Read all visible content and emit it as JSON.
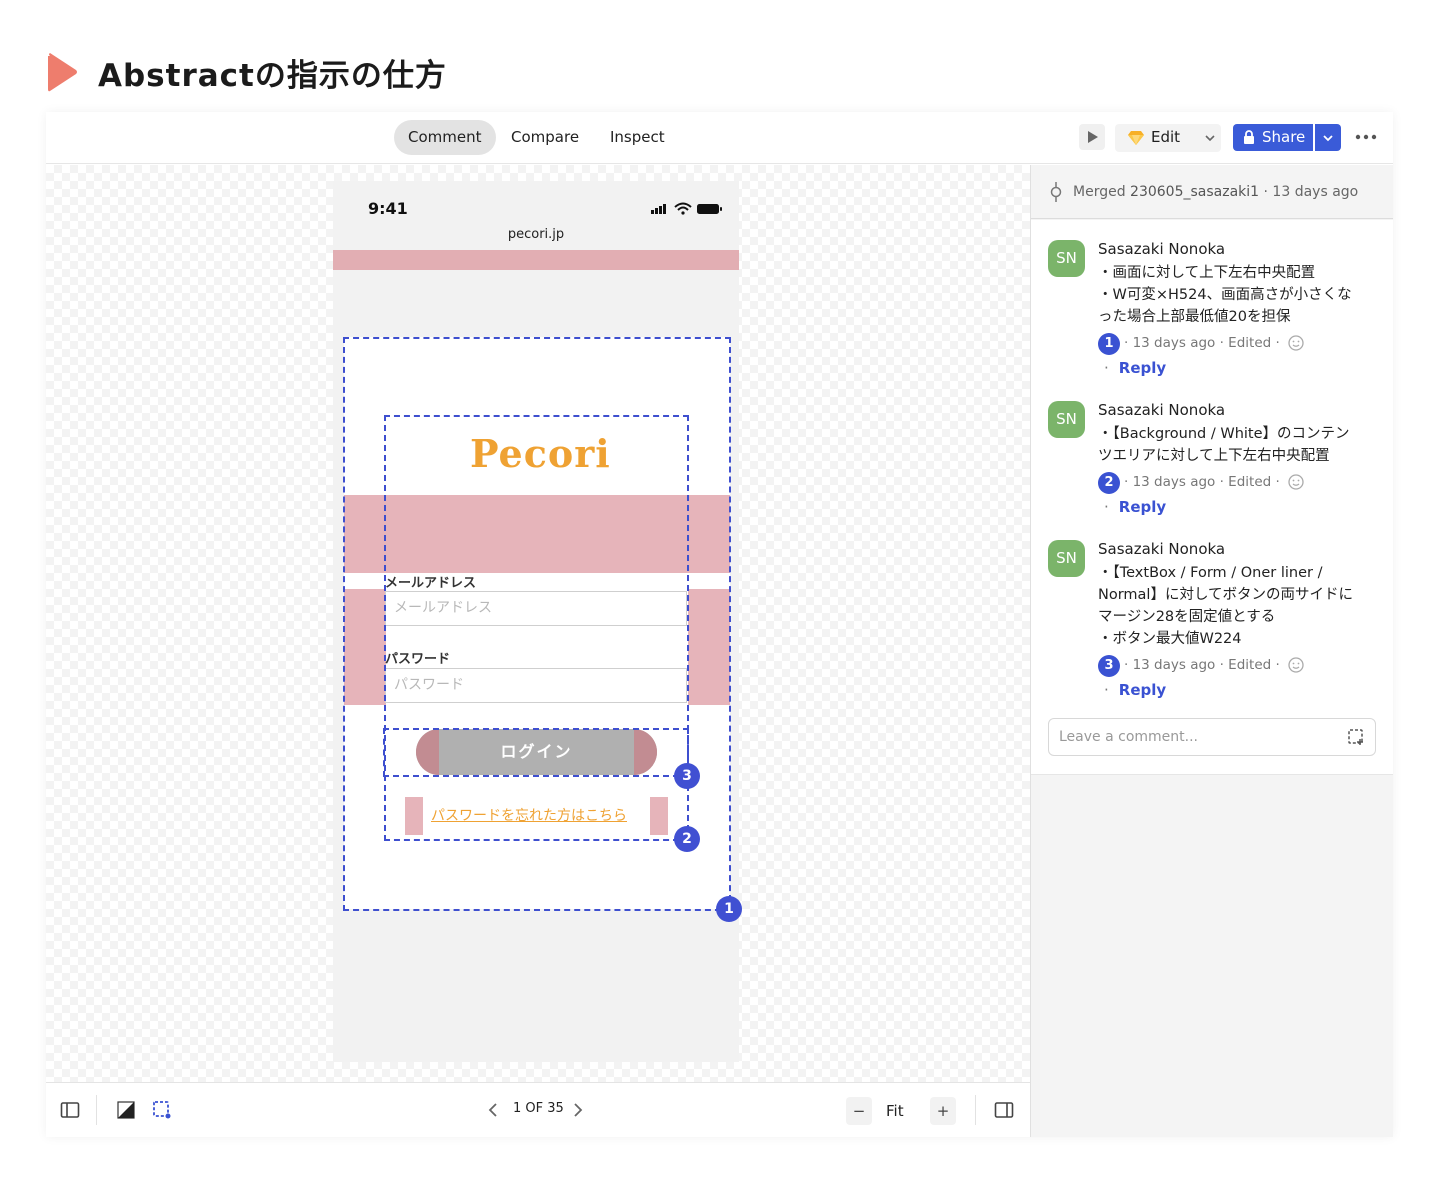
{
  "heading": {
    "title": "Abstractの指示の仕方",
    "icon": "play-icon"
  },
  "topbar": {
    "tabs": [
      {
        "label": "Comment",
        "active": true
      },
      {
        "label": "Compare",
        "active": false
      },
      {
        "label": "Inspect",
        "active": false
      }
    ],
    "edit_label": "Edit",
    "share_label": "Share"
  },
  "phone": {
    "time": "9:41",
    "url": "pecori.jp",
    "logo": "Pecori",
    "email_label": "メールアドレス",
    "email_placeholder": "メールアドレス",
    "password_label": "パスワード",
    "password_placeholder": "パスワード",
    "login_label": "ログイン",
    "forgot_label": "パスワードを忘れた方はこちら"
  },
  "markers": [
    "1",
    "2",
    "3"
  ],
  "bottombar": {
    "pager": "1 OF 35",
    "zoom_label": "Fit",
    "minus": "−",
    "plus": "+"
  },
  "sidebar": {
    "merged_prefix": "Merged",
    "merged_branch": "230605_sasazaki1",
    "merged_time": "· 13 days ago",
    "comments": [
      {
        "initials": "SN",
        "author": "Sasazaki Nonoka",
        "lines": [
          "・画面に対して上下左右中央配置",
          "・W可変×H524、画面高さが小さくな",
          "った場合上部最低値20を担保"
        ],
        "num": "1",
        "meta": "· 13 days ago · Edited ·",
        "reply": "Reply"
      },
      {
        "initials": "SN",
        "author": "Sasazaki Nonoka",
        "lines": [
          "・【Background / White】のコンテン",
          "ツエリアに対して上下左右中央配置"
        ],
        "num": "2",
        "meta": "· 13 days ago · Edited ·",
        "reply": "Reply"
      },
      {
        "initials": "SN",
        "author": "Sasazaki Nonoka",
        "lines": [
          "・【TextBox / Form / Oner liner /",
          "Normal】に対してボタンの両サイドに",
          "マージン28を固定値とする",
          "・ボタン最大値W224"
        ],
        "num": "3",
        "meta": "· 13 days ago · Edited ·",
        "reply": "Reply"
      }
    ],
    "leave_placeholder": "Leave a comment..."
  },
  "colors": {
    "accent": "#3a52d2",
    "avatar": "#7bb46a",
    "logo": "#efa233",
    "pink": "#e6b4ba",
    "play": "#ee7d6d"
  }
}
